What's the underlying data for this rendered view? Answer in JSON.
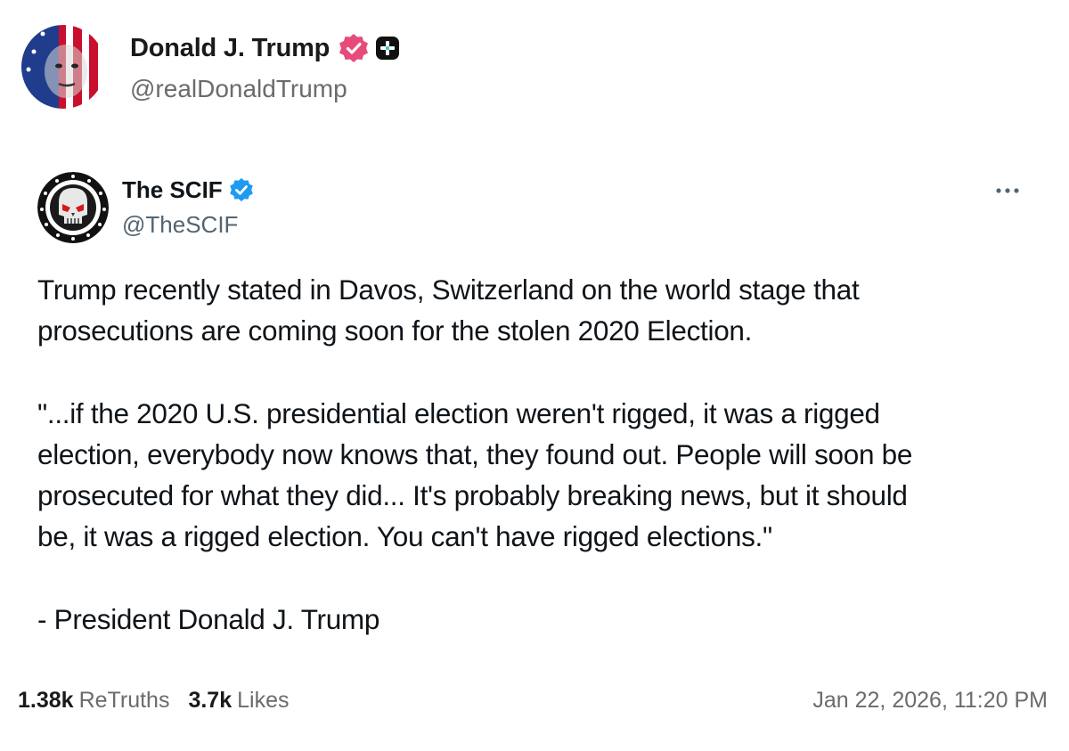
{
  "post": {
    "author_name": "Donald J. Trump",
    "author_handle": "@realDonaldTrump",
    "avatar_icon": "avatar-flag-portrait",
    "verified_icon": "verified-badge-icon",
    "verified_color": "#e64b7a",
    "plus_icon": "plus-badge-icon"
  },
  "quoted": {
    "author_name": "The SCIF",
    "author_handle": "@TheSCIF",
    "avatar_icon": "avatar-skull-emblem",
    "verified_icon": "verified-badge-icon",
    "verified_color": "#1d9bf0",
    "more_icon": "more-options-icon",
    "paragraphs": [
      "Trump recently stated in Davos, Switzerland on the world stage that\nprosecutions are coming soon for the stolen 2020 Election.",
      "\"...if the 2020 U.S. presidential election weren't rigged, it was a rigged\nelection, everybody now knows that, they found out. People will soon be\nprosecuted for what they did... It's probably breaking news, but it should\nbe, it was a rigged election. You can't have rigged elections.\"",
      "- President Donald J. Trump"
    ]
  },
  "footer": {
    "retruths_count": "1.38k",
    "retruths_label": "ReTruths",
    "likes_count": "3.7k",
    "likes_label": "Likes",
    "timestamp": "Jan 22, 2026, 11:20 PM"
  }
}
